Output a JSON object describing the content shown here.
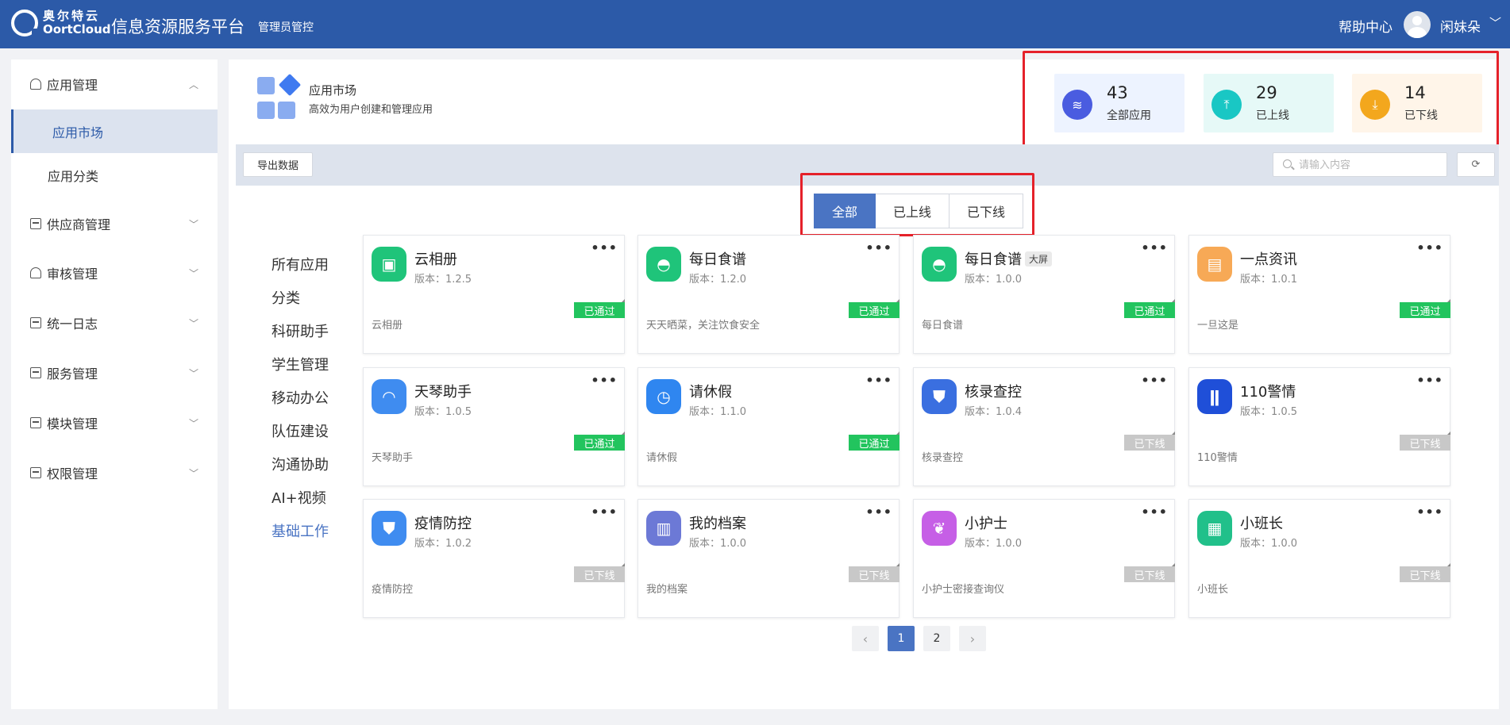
{
  "header": {
    "logo_cn": "奥尔特云",
    "logo_en": "OortCloud",
    "title": "信息资源服务平台",
    "subtitle": "管理员管控",
    "help": "帮助中心",
    "username": "闲妹朵"
  },
  "sidebar": {
    "groups": [
      {
        "label": "应用管理",
        "icon": "user-icon",
        "expanded": true
      },
      {
        "label": "供应商管理",
        "icon": "box-icon"
      },
      {
        "label": "审核管理",
        "icon": "stamp-icon"
      },
      {
        "label": "统一日志",
        "icon": "log-icon"
      },
      {
        "label": "服务管理",
        "icon": "service-icon"
      },
      {
        "label": "模块管理",
        "icon": "module-icon"
      },
      {
        "label": "权限管理",
        "icon": "permission-icon"
      }
    ],
    "sub_items": [
      {
        "label": "应用市场",
        "active": true
      },
      {
        "label": "应用分类"
      }
    ]
  },
  "market": {
    "title": "应用市场",
    "desc": "高效为用户创建和管理应用"
  },
  "stats": [
    {
      "value": "43",
      "label": "全部应用",
      "icon": "layers-icon",
      "color": "#4a5ce0",
      "bg": "#edf3ff"
    },
    {
      "value": "29",
      "label": "已上线",
      "icon": "upload-icon",
      "color": "#19c7c4",
      "bg": "#e6f9f7"
    },
    {
      "value": "14",
      "label": "已下线",
      "icon": "download-icon",
      "color": "#f3a71d",
      "bg": "#fff5e9"
    }
  ],
  "toolbar": {
    "export": "导出数据",
    "search_placeholder": "请输入内容"
  },
  "tabs": [
    {
      "label": "全部",
      "active": true
    },
    {
      "label": "已上线"
    },
    {
      "label": "已下线"
    }
  ],
  "categories": [
    {
      "label": "所有应用"
    },
    {
      "label": "分类"
    },
    {
      "label": "科研助手"
    },
    {
      "label": "学生管理"
    },
    {
      "label": "移动办公"
    },
    {
      "label": "队伍建设"
    },
    {
      "label": "沟通协助"
    },
    {
      "label": "AI+视频"
    },
    {
      "label": "基础工作",
      "active": true
    }
  ],
  "apps": [
    {
      "name": "云相册",
      "version": "版本：1.2.5",
      "status": "已通过",
      "desc": "云相册",
      "icon": "photo-icon",
      "color": "#1fc47a"
    },
    {
      "name": "每日食谱",
      "version": "版本：1.2.0",
      "status": "已通过",
      "desc": "天天晒菜，关注饮食安全",
      "icon": "dish-icon",
      "color": "#1fc47a"
    },
    {
      "name": "每日食谱",
      "tag": "大屏",
      "version": "版本：1.0.0",
      "status": "已通过",
      "desc": "每日食谱",
      "icon": "dish-icon",
      "color": "#1fc47a"
    },
    {
      "name": "一点资讯",
      "version": "版本：1.0.1",
      "status": "已通过",
      "desc": "一旦这是",
      "icon": "archive-icon",
      "color": "#f7a956"
    },
    {
      "name": "天琴助手",
      "version": "版本：1.0.5",
      "status": "已通过",
      "desc": "天琴助手",
      "icon": "bird-icon",
      "color": "#3f8cf0"
    },
    {
      "name": "请休假",
      "version": "版本：1.1.0",
      "status": "已通过",
      "desc": "请休假",
      "icon": "clock-icon",
      "color": "#2f86f0"
    },
    {
      "name": "核录查控",
      "version": "版本：1.0.4",
      "status": "已下线",
      "desc": "核录查控",
      "icon": "shield-icon",
      "color": "#3a6fe0"
    },
    {
      "name": "110警情",
      "version": "版本：1.0.5",
      "status": "已下线",
      "desc": "110警情",
      "icon": "police-icon",
      "color": "#1f4fd8"
    },
    {
      "name": "疫情防控",
      "version": "版本：1.0.2",
      "status": "已下线",
      "desc": "疫情防控",
      "icon": "shield-bolt-icon",
      "color": "#3f8cf0"
    },
    {
      "name": "我的档案",
      "version": "版本：1.0.0",
      "status": "已下线",
      "desc": "我的档案",
      "icon": "folder-icon",
      "color": "#6c79d6"
    },
    {
      "name": "小护士",
      "version": "版本：1.0.0",
      "status": "已下线",
      "desc": "小护士密接查询仪",
      "icon": "nurse-icon",
      "color": "#c65fe6"
    },
    {
      "name": "小班长",
      "version": "版本：1.0.0",
      "status": "已下线",
      "desc": "小班长",
      "icon": "board-icon",
      "color": "#21c08a"
    }
  ],
  "pagination": {
    "pages": [
      "1",
      "2"
    ],
    "current": "1"
  }
}
